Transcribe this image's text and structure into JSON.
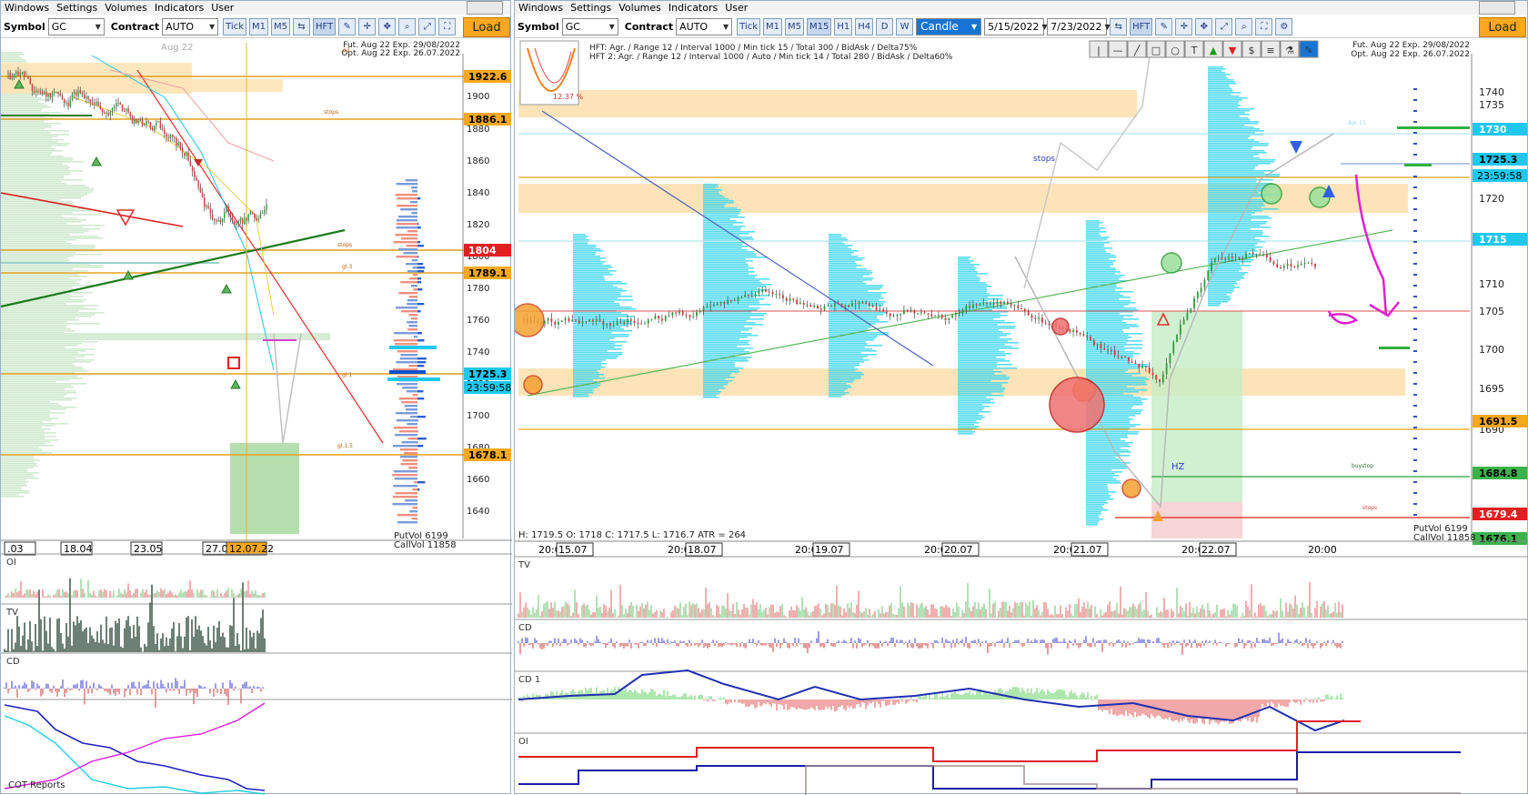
{
  "menu": [
    "Windows",
    "Settings",
    "Volumes",
    "Indicators",
    "User"
  ],
  "left": {
    "symbol_label": "Symbol",
    "symbol": "GC",
    "contract_label": "Contract",
    "contract": "AUTO",
    "tf_buttons": [
      "Tick",
      "M1",
      "M5"
    ],
    "hft": "HFT",
    "load": "Load",
    "info1": "Fut. Aug 22 Exp. 29/08/2022",
    "info2": "Opt. Aug 22 Exp. 26.07.2022",
    "watermark": "Aug 22",
    "price_labels": [
      "1922.6",
      "1886.1",
      "1804",
      "1789.1",
      "1725.3",
      "23:59:58",
      "1678.1"
    ],
    "axis_ticks": [
      "1900",
      "1880",
      "1860",
      "1840",
      "1820",
      "1800",
      "1780",
      "1760",
      "1740",
      "1720",
      "1700",
      "1680",
      "1660",
      "1640"
    ],
    "date_ticks": [
      ".03",
      "18.04",
      "23.05",
      "27.0",
      "12.07.22"
    ],
    "put_vol": "PutVol  6199",
    "call_vol": "CallVol  11858",
    "small_labels": [
      "stops",
      "stops",
      "gl.3",
      "gl.1",
      "gl.1.5",
      "p3"
    ],
    "panes": [
      "OI",
      "TV",
      "CD",
      "COT Reports"
    ]
  },
  "right": {
    "symbol_label": "Symbol",
    "symbol": "GC",
    "contract_label": "Contract",
    "contract": "AUTO",
    "tf_buttons": [
      "Tick",
      "M1",
      "M5",
      "M15",
      "H1",
      "H4",
      "D",
      "W"
    ],
    "chart_type": "Candle",
    "date_from": "5/15/2022",
    "date_to": "7/23/2022",
    "hft": "HFT",
    "load": "Load",
    "info1": "Fut. Aug 22 Exp. 29/08/2022",
    "info2": "Opt. Aug 22 Exp. 26.07.2022",
    "hft_line1": "HFT: Agr. / Range 12 / Interval 1000 / Min tick 15 / Total 300 / BidAsk / Delta75%",
    "hft_line2": "HFT 2: Agr. / Range 12 / Interval 1000 / Auto / Min tick 14 / Total 280 / BidAsk / Delta60%",
    "thumb_pct": "12.37 %",
    "ohlc": "H: 1719.5   O: 1718   C: 1717.5   L: 1716.7   ATR = 264",
    "price_labels": [
      "1730",
      "1725.3",
      "23:59:58",
      "1715",
      "1691.5",
      "1684.8",
      "1679.4",
      "1676.1"
    ],
    "axis_ticks": [
      "1740",
      "1735",
      "1725",
      "1720",
      "1710",
      "1705",
      "1700",
      "1695",
      "1690"
    ],
    "date_ticks": [
      "20:0",
      "15.07",
      "20:0",
      "18.07",
      "20:0",
      "19.07",
      "20:0",
      "20.07",
      "20:0",
      "21.07",
      "20:0",
      "22.07",
      "20:00"
    ],
    "put_vol": "PutVol  6199",
    "call_vol": "CallVol  11858",
    "annotations": [
      "stops",
      "HZ",
      "Apr 21",
      "buystop",
      "stops"
    ],
    "panes": [
      "TV",
      "CD",
      "CD 1",
      "OI"
    ]
  },
  "colors": {
    "accent": "#f9a81f",
    "bull": "#2e9e3a",
    "bear": "#d23a3a",
    "zone": "#fde4b8",
    "profile": "#3fd7ec",
    "panel_border": "#9bb0c8"
  }
}
